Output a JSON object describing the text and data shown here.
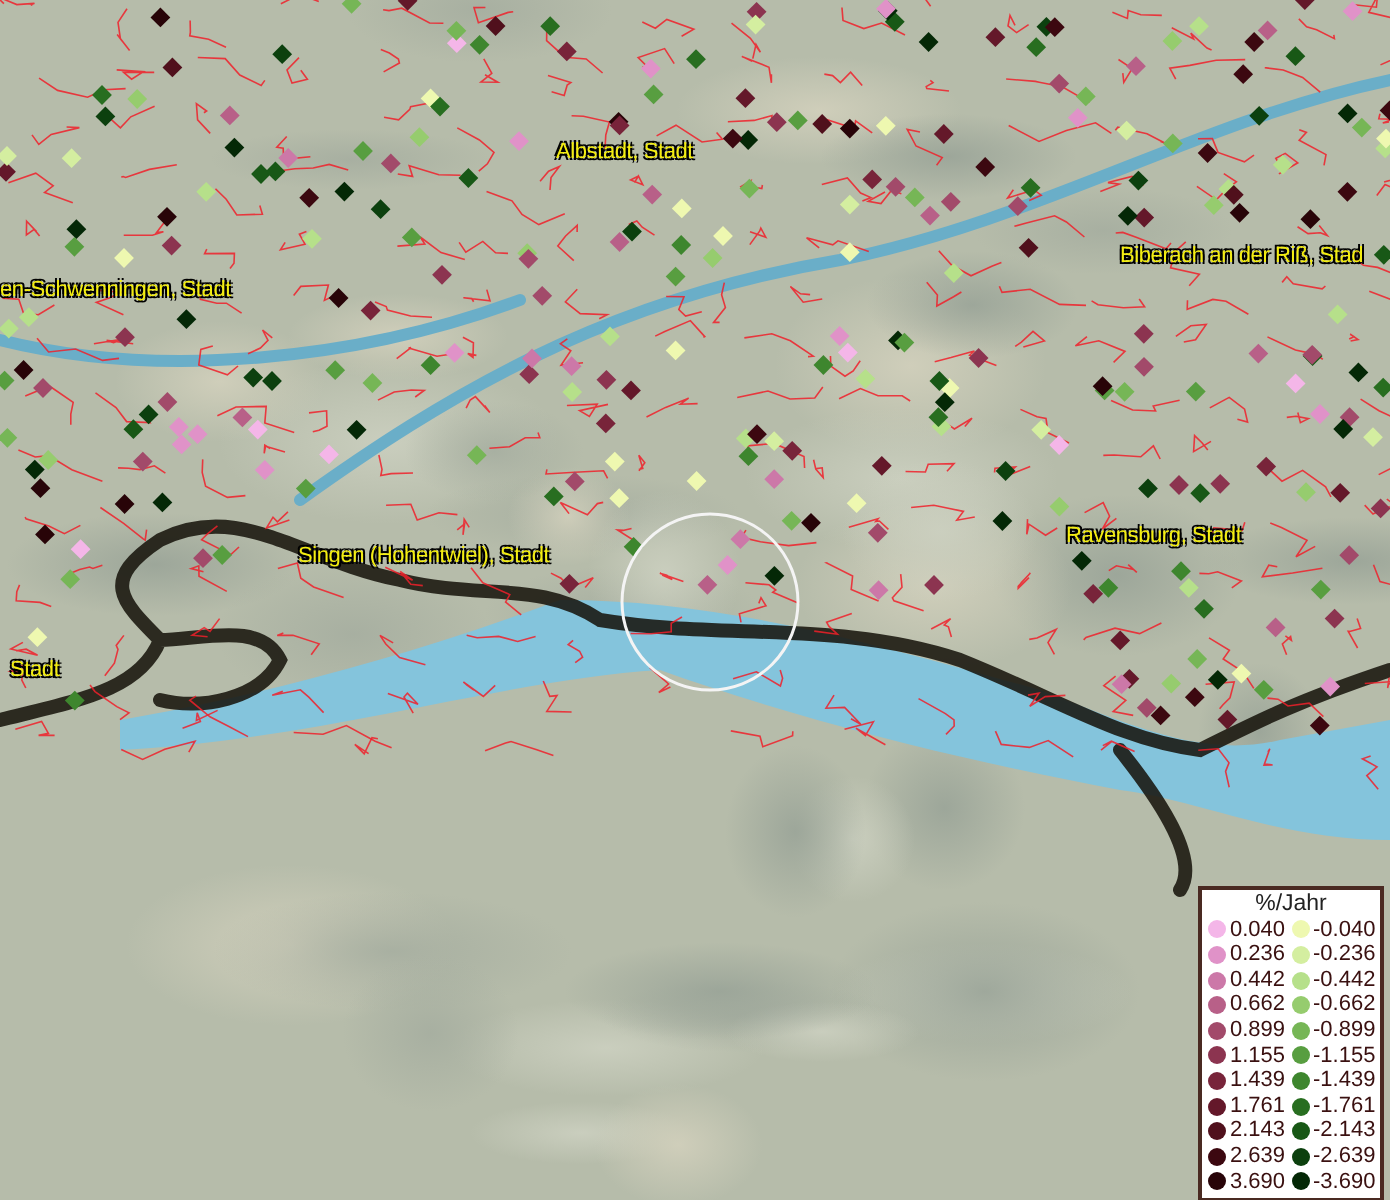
{
  "map_labels": [
    "Albstadt, Stadt",
    "en-Schwenningen, Stadt",
    "Biberach an der Riß, Stad",
    "Singen (Hohentwiel), Stadt",
    "Ravensburg, Stadt",
    "Stadt"
  ],
  "legend": {
    "title": "%/Jahr",
    "rows": [
      {
        "left": {
          "value": "0.040",
          "color": "#f4b6e8"
        },
        "right": {
          "value": "-0.040",
          "color": "#eef8b0"
        }
      },
      {
        "left": {
          "value": "0.236",
          "color": "#e092c8"
        },
        "right": {
          "value": "-0.236",
          "color": "#d4eea0"
        }
      },
      {
        "left": {
          "value": "0.442",
          "color": "#cc78a8"
        },
        "right": {
          "value": "-0.442",
          "color": "#b6e08a"
        }
      },
      {
        "left": {
          "value": "0.662",
          "color": "#b86088"
        },
        "right": {
          "value": "-0.662",
          "color": "#96cc6e"
        }
      },
      {
        "left": {
          "value": "0.899",
          "color": "#a24a6a"
        },
        "right": {
          "value": "-0.899",
          "color": "#76b656"
        }
      },
      {
        "left": {
          "value": "1.155",
          "color": "#8c3450"
        },
        "right": {
          "value": "-1.155",
          "color": "#589e40"
        }
      },
      {
        "left": {
          "value": "1.439",
          "color": "#78243a"
        },
        "right": {
          "value": "-1.439",
          "color": "#3e862e"
        }
      },
      {
        "left": {
          "value": "1.761",
          "color": "#64182a"
        },
        "right": {
          "value": "-1.761",
          "color": "#286e20"
        }
      },
      {
        "left": {
          "value": "2.143",
          "color": "#50101c"
        },
        "right": {
          "value": "-2.143",
          "color": "#185816"
        }
      },
      {
        "left": {
          "value": "2.639",
          "color": "#3c0810"
        },
        "right": {
          "value": "-2.639",
          "color": "#0c400e"
        }
      },
      {
        "left": {
          "value": "3.690",
          "color": "#280408"
        },
        "right": {
          "value": "-3.690",
          "color": "#042806"
        }
      }
    ]
  }
}
